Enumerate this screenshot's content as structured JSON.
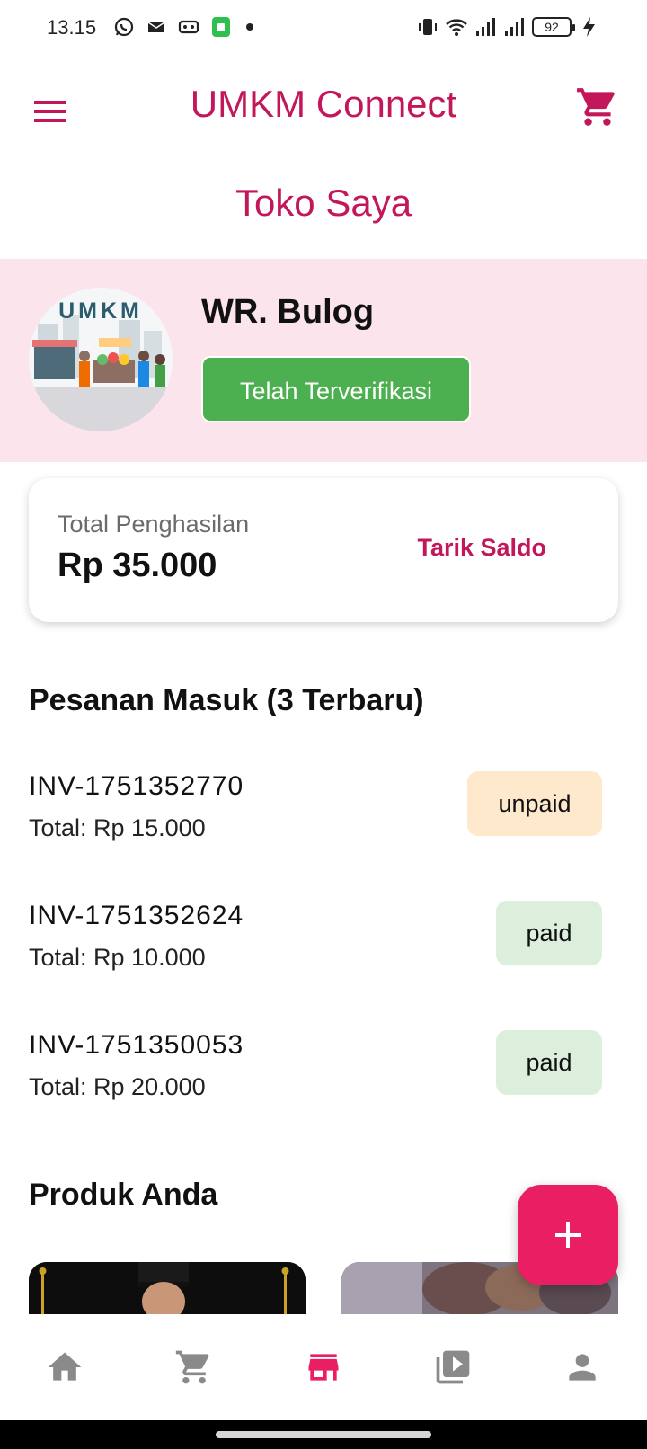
{
  "status_bar": {
    "time": "13.15",
    "battery": "92"
  },
  "app_bar": {
    "title": "UMKM Connect"
  },
  "page": {
    "title": "Toko Saya"
  },
  "profile": {
    "shop_name": "WR. Bulog",
    "verified_label": "Telah Terverifikasi",
    "avatar_text": "UMKM"
  },
  "earnings": {
    "label": "Total Penghasilan",
    "value": "Rp 35.000",
    "withdraw_label": "Tarik Saldo"
  },
  "orders_section": {
    "title": "Pesanan Masuk (3 Terbaru)",
    "orders": [
      {
        "invoice": "INV-1751352770",
        "total": "Total: Rp 15.000",
        "status": "unpaid"
      },
      {
        "invoice": "INV-1751352624",
        "total": "Total: Rp 10.000",
        "status": "paid"
      },
      {
        "invoice": "INV-1751350053",
        "total": "Total: Rp 20.000",
        "status": "paid"
      }
    ]
  },
  "products_section": {
    "title": "Produk Anda"
  },
  "fab": {
    "label": "+"
  },
  "bottom_nav": {
    "items": [
      "home-icon",
      "cart-icon",
      "store-icon",
      "video-library-icon",
      "person-icon"
    ],
    "active": "store-icon"
  },
  "colors": {
    "primary": "#c2185b",
    "fab": "#e91e63",
    "verified": "#4caf50",
    "band": "#fbe4ec",
    "unpaid_bg": "#ffe9cc",
    "paid_bg": "#dcefdc",
    "nav_inactive": "#8a8a8a"
  }
}
